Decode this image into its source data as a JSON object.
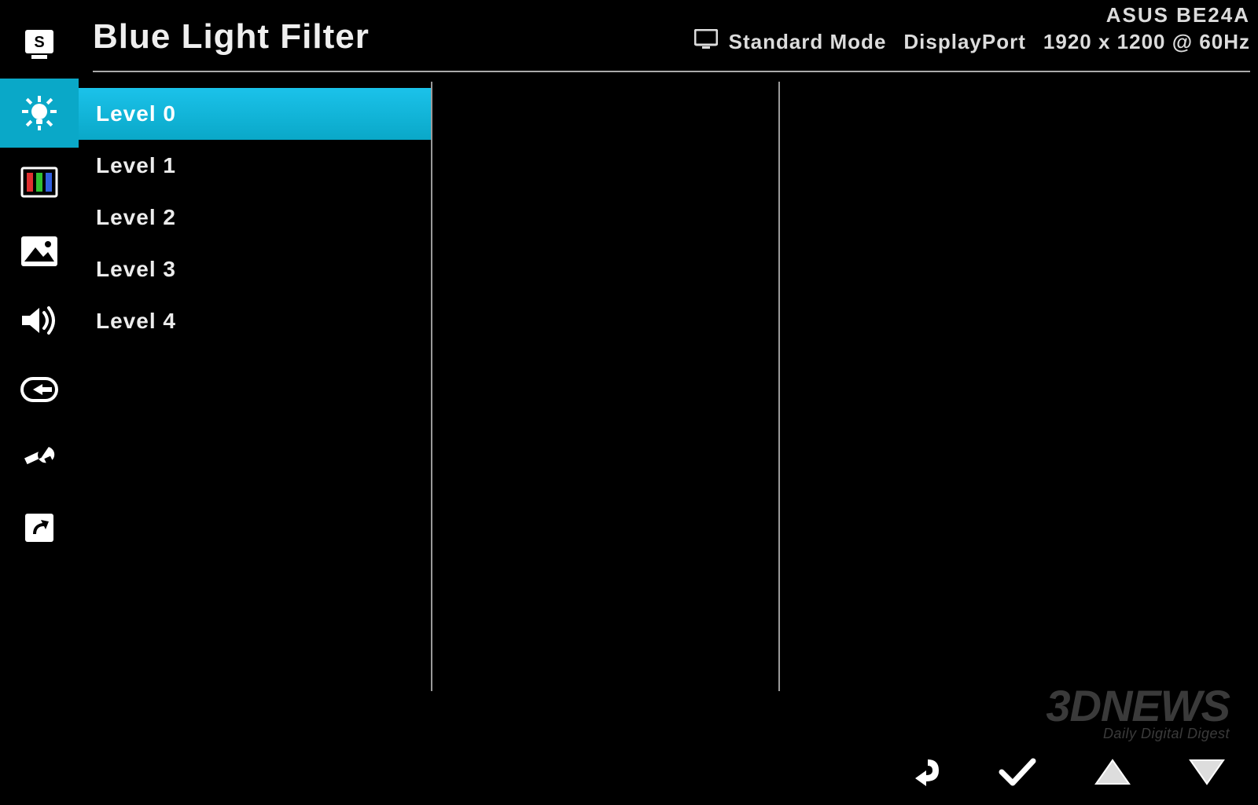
{
  "header": {
    "title": "Blue Light Filter",
    "model": "ASUS BE24A",
    "mode": "Standard Mode",
    "input": "DisplayPort",
    "resolution": "1920 x 1200 @ 60Hz"
  },
  "sidebar": {
    "items": [
      {
        "id": "splendid",
        "icon": "splendid-icon"
      },
      {
        "id": "blue-light",
        "icon": "bulb-icon",
        "active": true
      },
      {
        "id": "color",
        "icon": "color-bars-icon"
      },
      {
        "id": "image",
        "icon": "image-icon"
      },
      {
        "id": "sound",
        "icon": "speaker-icon"
      },
      {
        "id": "input-select",
        "icon": "input-icon"
      },
      {
        "id": "system-setup",
        "icon": "wrench-icon"
      },
      {
        "id": "shortcut",
        "icon": "shortcut-icon"
      }
    ]
  },
  "options": [
    {
      "label": "Level 0",
      "selected": true
    },
    {
      "label": "Level 1"
    },
    {
      "label": "Level 2"
    },
    {
      "label": "Level 3"
    },
    {
      "label": "Level 4"
    }
  ],
  "footer": {
    "buttons": [
      {
        "id": "back",
        "icon": "back-icon"
      },
      {
        "id": "confirm",
        "icon": "check-icon"
      },
      {
        "id": "up",
        "icon": "up-icon"
      },
      {
        "id": "down",
        "icon": "down-icon"
      }
    ]
  },
  "watermark": {
    "line1": "3DNEWS",
    "line2": "Daily Digital Digest"
  }
}
